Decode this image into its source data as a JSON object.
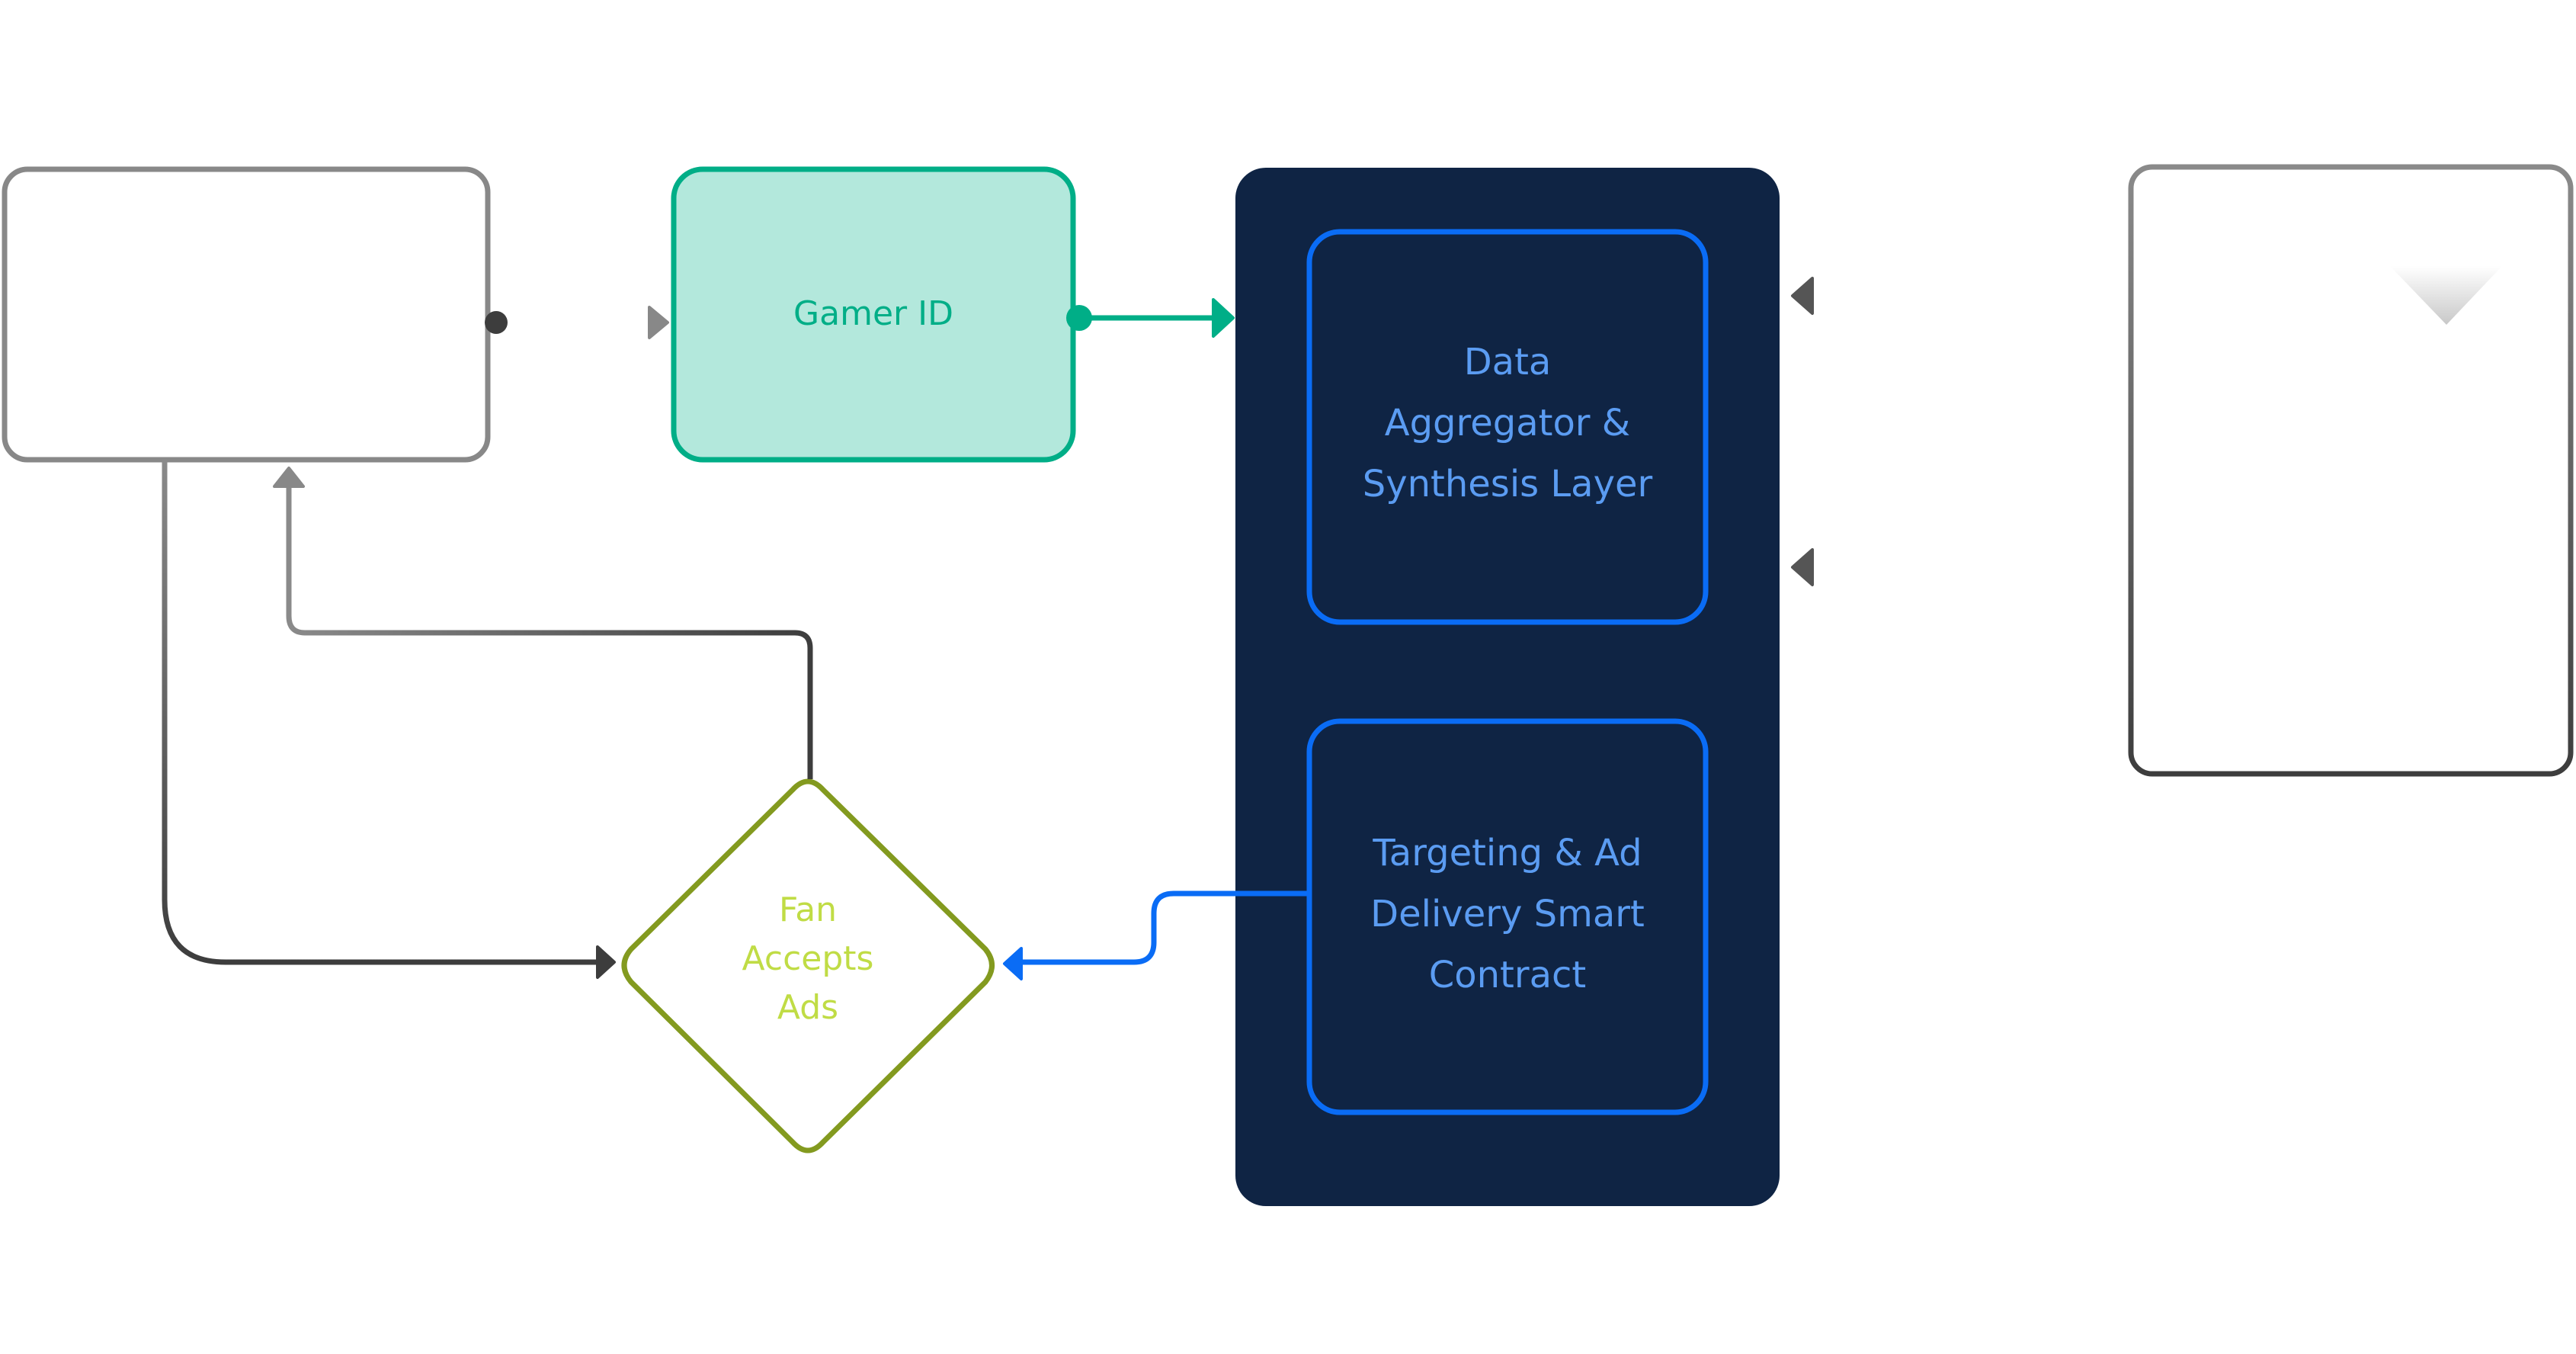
{
  "diagram": {
    "nodes": {
      "source_box": {
        "label": "",
        "shape": "rounded-rect",
        "stroke": "#888888",
        "fill": "#ffffff"
      },
      "gamer_id": {
        "label": "Gamer ID",
        "shape": "rounded-rect",
        "stroke": "#00ae87",
        "fill": "#b3e8dc",
        "text_color": "#00ae87"
      },
      "platform_panel": {
        "label": "",
        "shape": "rounded-rect",
        "fill": "#0f2444"
      },
      "data_aggregator": {
        "lines": [
          "Data",
          "Aggregator &",
          "Synthesis Layer"
        ],
        "shape": "rounded-rect",
        "stroke": "#0a6cf5",
        "text_color": "#5b9cf2"
      },
      "targeting_contract": {
        "lines": [
          "Targeting & Ad",
          "Delivery Smart",
          "Contract"
        ],
        "shape": "rounded-rect",
        "stroke": "#0a6cf5",
        "text_color": "#5b9cf2"
      },
      "fan_accepts_ads": {
        "lines": [
          "Fan",
          "Accepts",
          "Ads"
        ],
        "shape": "diamond",
        "stroke": "#839a1f",
        "text_color": "#c0dc45"
      },
      "external_box": {
        "label": "",
        "shape": "rounded-rect",
        "stroke": "#777777",
        "fill": "#ffffff"
      }
    },
    "edges": [
      {
        "from": "source_box",
        "to": "gamer_id",
        "color": "#555555"
      },
      {
        "from": "gamer_id",
        "to": "platform_panel",
        "color": "#00ae87"
      },
      {
        "from": "external_box",
        "to": "data_aggregator",
        "color": "#555555"
      },
      {
        "from": "external_box",
        "to": "data_aggregator",
        "color": "#555555"
      },
      {
        "from": "targeting_contract",
        "to": "fan_accepts_ads",
        "color": "#0a6cf5"
      },
      {
        "from": "source_box",
        "to": "fan_accepts_ads",
        "color": "#3d3d3d"
      },
      {
        "from": "fan_accepts_ads",
        "to": "source_box",
        "color": "#888888"
      }
    ]
  }
}
